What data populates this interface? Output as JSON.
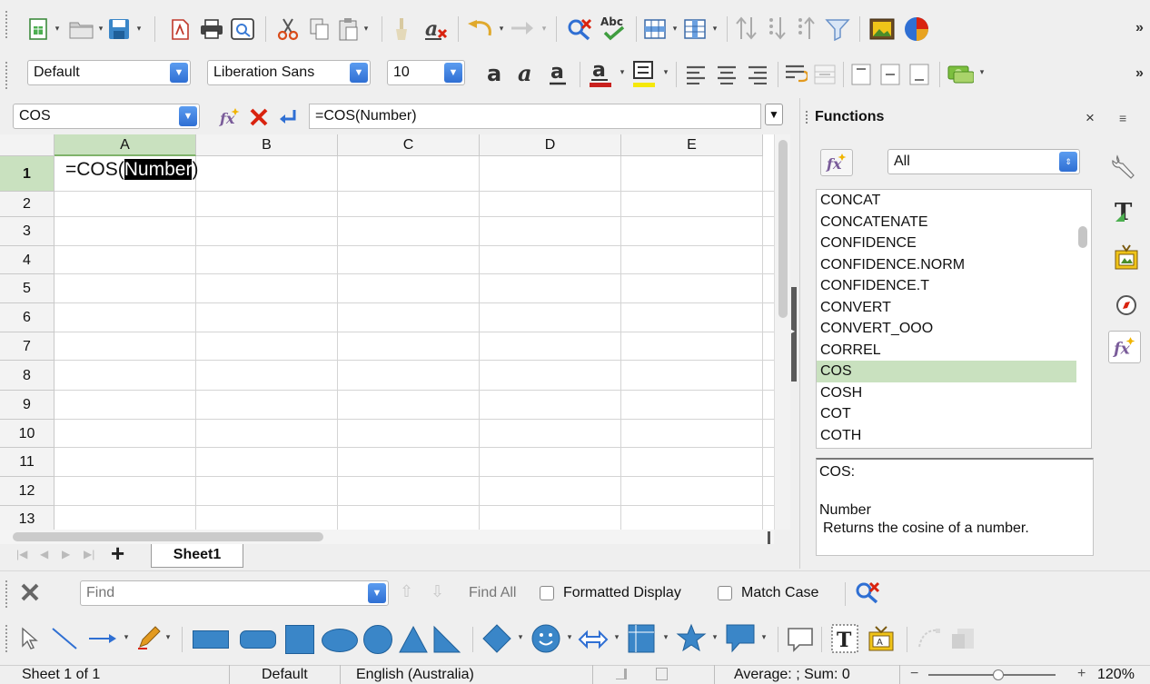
{
  "toolbar_formatting": {
    "paragraph_style": "Default",
    "font_name": "Liberation Sans",
    "font_size": "10"
  },
  "formula_bar": {
    "name_box": "COS",
    "content": "=COS(Number)"
  },
  "sheet": {
    "columns": [
      "A",
      "B",
      "C",
      "D",
      "E"
    ],
    "rows": [
      "1",
      "2",
      "3",
      "4",
      "5",
      "6",
      "7",
      "8",
      "9",
      "10",
      "11",
      "12",
      "13"
    ],
    "cell_a1_prefix": "=COS(",
    "cell_a1_selected": "Number",
    "cell_a1_suffix": ")"
  },
  "sheet_tabs": {
    "add_label": "+",
    "active_tab": "Sheet1"
  },
  "find_bar": {
    "placeholder": "Find",
    "find_all": "Find All",
    "formatted_display": "Formatted Display",
    "match_case": "Match Case"
  },
  "sidebar": {
    "title": "Functions",
    "category": "All",
    "functions": [
      "CONCAT",
      "CONCATENATE",
      "CONFIDENCE",
      "CONFIDENCE.NORM",
      "CONFIDENCE.T",
      "CONVERT",
      "CONVERT_OOO",
      "CORREL",
      "COS",
      "COSH",
      "COT",
      "COTH"
    ],
    "selected_function": "COS",
    "description_name": "COS:",
    "description_param": "Number",
    "description_text": "Returns the cosine of a number."
  },
  "status_bar": {
    "sheet_position": "Sheet 1 of 1",
    "page_style": "Default",
    "language": "English (Australia)",
    "summary": "Average: ; Sum: 0",
    "zoom": "120%",
    "zoom_fraction": 0.55
  },
  "colors": {
    "selection_green": "#c9e1bf",
    "accent_blue": "#2f6fd3",
    "delete_red": "#d9230f"
  }
}
